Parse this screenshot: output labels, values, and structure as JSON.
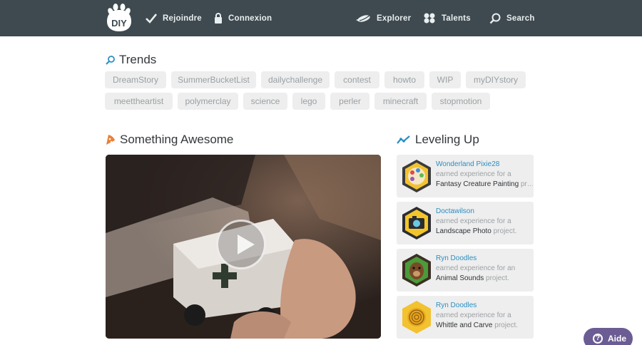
{
  "header": {
    "logo_text": "DIY",
    "nav_left": [
      {
        "label": "Rejoindre",
        "icon": "check-icon"
      },
      {
        "label": "Connexion",
        "icon": "lock-icon"
      }
    ],
    "nav_right": [
      {
        "label": "Explorer",
        "icon": "rocket-icon"
      },
      {
        "label": "Talents",
        "icon": "talents-icon"
      },
      {
        "label": "Search",
        "icon": "search-icon"
      }
    ]
  },
  "trends": {
    "title": "Trends",
    "tags": [
      "DreamStory",
      "SummerBucketList",
      "dailychallenge",
      "contest",
      "howto",
      "WIP",
      "myDIYstory",
      "meettheartist",
      "polymerclay",
      "science",
      "lego",
      "perler",
      "minecraft",
      "stopmotion"
    ]
  },
  "awesome": {
    "title": "Something Awesome"
  },
  "leveling": {
    "title": "Leveling Up",
    "items": [
      {
        "user": "Wonderland Pixie28",
        "text": "earned experience for a",
        "project": "Fantasy Creature Painting",
        "suffix": " pr…"
      },
      {
        "user": "Doctawilson",
        "text": "earned experience for a",
        "project": "Landscape Photo",
        "suffix": " project."
      },
      {
        "user": "Ryn Doodles",
        "text": "earned experience for an",
        "project": "Animal Sounds",
        "suffix": " project."
      },
      {
        "user": "Ryn Doodles",
        "text": "earned experience for a",
        "project": "Whittle and Carve",
        "suffix": " project."
      }
    ]
  },
  "help": {
    "label": "Aide",
    "icon_glyph": "?"
  },
  "colors": {
    "header_bg": "#3e4a4f",
    "link_blue": "#2a8fc2",
    "accent_orange": "#e8813a",
    "help_purple": "#6b5d93"
  }
}
